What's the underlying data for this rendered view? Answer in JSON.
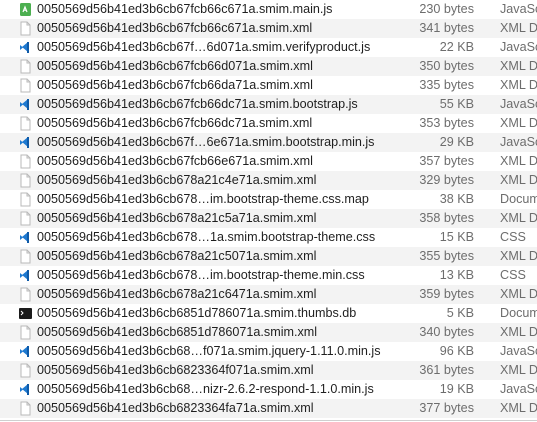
{
  "files": [
    {
      "name": "0050569d56b41ed3b6cb67fcb66c671a.smim.main.js",
      "size": "230 bytes",
      "kind": "JavaSc",
      "icon": "js-green-icon"
    },
    {
      "name": "0050569d56b41ed3b6cb67fcb66c671a.smim.xml",
      "size": "341 bytes",
      "kind": "XML D",
      "icon": "file-icon"
    },
    {
      "name": "0050569d56b41ed3b6cb67f…6d071a.smim.verifyproduct.js",
      "size": "22 KB",
      "kind": "JavaSc",
      "icon": "vscode-icon"
    },
    {
      "name": "0050569d56b41ed3b6cb67fcb66d071a.smim.xml",
      "size": "350 bytes",
      "kind": "XML D",
      "icon": "file-icon"
    },
    {
      "name": "0050569d56b41ed3b6cb67fcb66da71a.smim.xml",
      "size": "335 bytes",
      "kind": "XML D",
      "icon": "file-icon"
    },
    {
      "name": "0050569d56b41ed3b6cb67fcb66dc71a.smim.bootstrap.js",
      "size": "55 KB",
      "kind": "JavaSc",
      "icon": "vscode-icon"
    },
    {
      "name": "0050569d56b41ed3b6cb67fcb66dc71a.smim.xml",
      "size": "353 bytes",
      "kind": "XML D",
      "icon": "file-icon"
    },
    {
      "name": "0050569d56b41ed3b6cb67f…6e671a.smim.bootstrap.min.js",
      "size": "29 KB",
      "kind": "JavaSc",
      "icon": "vscode-icon"
    },
    {
      "name": "0050569d56b41ed3b6cb67fcb66e671a.smim.xml",
      "size": "357 bytes",
      "kind": "XML D",
      "icon": "file-icon"
    },
    {
      "name": "0050569d56b41ed3b6cb678a21c4e71a.smim.xml",
      "size": "329 bytes",
      "kind": "XML D",
      "icon": "file-icon"
    },
    {
      "name": "0050569d56b41ed3b6cb678…im.bootstrap-theme.css.map",
      "size": "38 KB",
      "kind": "Docum",
      "icon": "file-icon"
    },
    {
      "name": "0050569d56b41ed3b6cb678a21c5a71a.smim.xml",
      "size": "358 bytes",
      "kind": "XML D",
      "icon": "file-icon"
    },
    {
      "name": "0050569d56b41ed3b6cb678…1a.smim.bootstrap-theme.css",
      "size": "15 KB",
      "kind": "CSS",
      "icon": "vscode-icon"
    },
    {
      "name": "0050569d56b41ed3b6cb678a21c5071a.smim.xml",
      "size": "355 bytes",
      "kind": "XML D",
      "icon": "file-icon"
    },
    {
      "name": "0050569d56b41ed3b6cb678…im.bootstrap-theme.min.css",
      "size": "13 KB",
      "kind": "CSS",
      "icon": "vscode-icon"
    },
    {
      "name": "0050569d56b41ed3b6cb678a21c6471a.smim.xml",
      "size": "359 bytes",
      "kind": "XML D",
      "icon": "file-icon"
    },
    {
      "name": "0050569d56b41ed3b6cb6851d786071a.smim.thumbs.db",
      "size": "5 KB",
      "kind": "Docum",
      "icon": "terminal-icon"
    },
    {
      "name": "0050569d56b41ed3b6cb6851d786071a.smim.xml",
      "size": "340 bytes",
      "kind": "XML D",
      "icon": "file-icon"
    },
    {
      "name": "0050569d56b41ed3b6cb68…f071a.smim.jquery-1.11.0.min.js",
      "size": "96 KB",
      "kind": "JavaSc",
      "icon": "vscode-icon"
    },
    {
      "name": "0050569d56b41ed3b6cb6823364f071a.smim.xml",
      "size": "361 bytes",
      "kind": "XML D",
      "icon": "file-icon"
    },
    {
      "name": "0050569d56b41ed3b6cb68…nizr-2.6.2-respond-1.1.0.min.js",
      "size": "19 KB",
      "kind": "JavaSc",
      "icon": "vscode-icon"
    },
    {
      "name": "0050569d56b41ed3b6cb6823364fa71a.smim.xml",
      "size": "377 bytes",
      "kind": "XML D",
      "icon": "file-icon"
    }
  ],
  "colors": {
    "stripe": "#f3f3f3",
    "vscode_blue": "#1f7ad1",
    "js_green": "#4caf50",
    "terminal_black": "#1b1b1b"
  }
}
